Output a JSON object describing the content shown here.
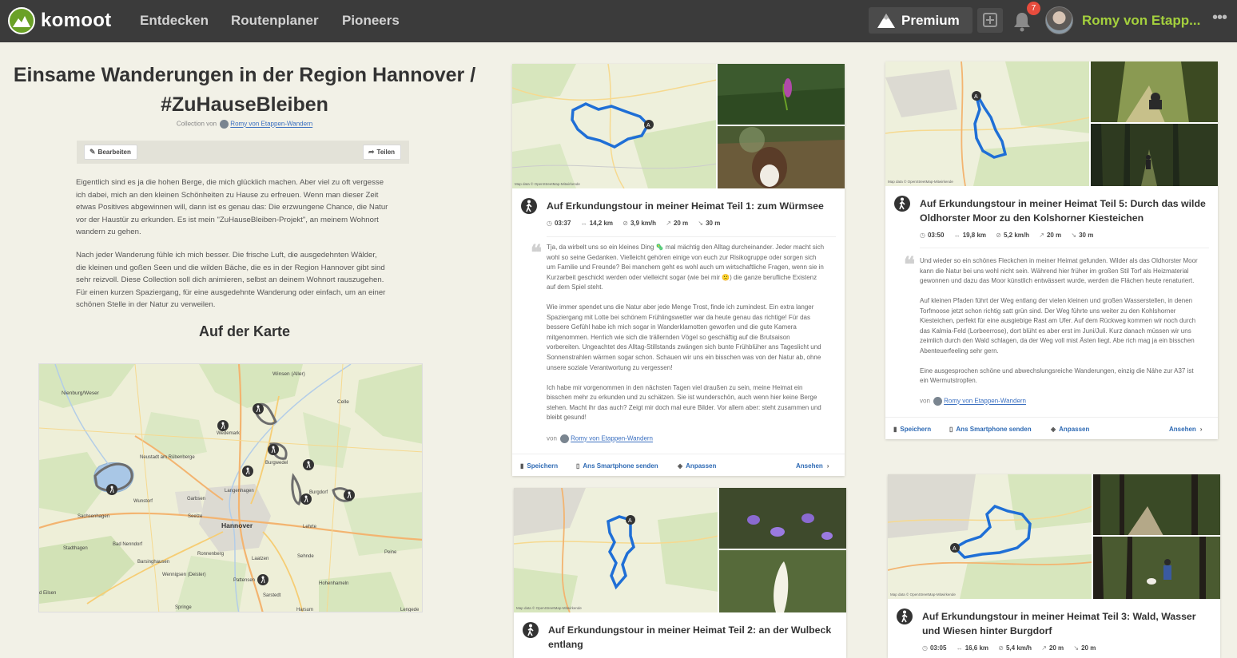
{
  "app": {
    "logo_text": "komoot",
    "nav": [
      "Entdecken",
      "Routenplaner",
      "Pioneers"
    ],
    "premium_label": "Premium",
    "notification_count": "7",
    "user_name": "Romy von Etapp...",
    "more": "•••"
  },
  "collection": {
    "title_line1": "Einsame Wanderungen in der Region Hannover /",
    "title_line2": "#ZuHauseBleiben",
    "byline_prefix": "Collection von",
    "byline_author": "Romy von Etappen-Wandern",
    "edit_label": "Bearbeiten",
    "share_label": "Teilen",
    "paragraph1_lines": [
      "Eigentlich sind es ja die hohen Berge, die mich glücklich machen. Aber viel zu oft vergesse",
      "ich dabei, mich an den kleinen Schönheiten zu Hause zu erfreuen. Wenn man dieser Zeit",
      "etwas Positives abgewinnen will, dann ist es genau das: Die erzwungene Chance, die Natur",
      "vor der Haustür zu erkunden. Es ist mein \"ZuHauseBleiben-Projekt\", an meinem Wohnort",
      "wandern zu gehen."
    ],
    "paragraph2_lines": [
      "Nach jeder Wanderung fühle ich mich besser. Die frische Luft, die ausgedehnten Wälder,",
      "die kleinen und goßen Seen und die wilden Bäche, die es in der Region Hannover gibt sind",
      "sehr reizvoll. Diese Collection soll dich animieren, selbst an deinem Wohnort rauszugehen.",
      "Für einen kurzen Spaziergang, für eine ausgedehnte Wanderung oder einfach, um an einer",
      "schönen Stelle in der Natur zu verweilen."
    ],
    "map_heading": "Auf der Karte"
  },
  "overview_map_labels": {
    "winsen": "Winsen (Aller)",
    "nienburg": "Nienburg/Weser",
    "celle": "Celle",
    "wedemark": "Wedemark",
    "neustadt": "Neustadt am Rübenberge",
    "burgwedel": "Burgwedel",
    "langenhagen": "Langenhagen",
    "burgdorf": "Burgdorf",
    "wunstorf": "Wunstorf",
    "garbsen": "Garbsen",
    "sachsenhagen": "Sachsenhagen",
    "seelze": "Seelze",
    "hannover": "Hannover",
    "lehrte": "Lehrte",
    "stadthagen": "Stadthagen",
    "badnenndorf": "Bad Nenndorf",
    "ronnenberg": "Ronnenberg",
    "sehnde": "Sehnde",
    "peine": "Peine",
    "barsinghausen": "Barsinghausen",
    "laatzen": "Laatzen",
    "wennigsen": "Wennigsen (Deister)",
    "pattensen": "Pattensen",
    "hohenhameln": "Hohenhameln",
    "elsen": "d Eilsen",
    "sarstedt": "Sarstedt",
    "springe": "Springe",
    "harsum": "Harsum",
    "lengede": "Lengede"
  },
  "tours": [
    {
      "title_lines": [
        "Auf Erkundungstour in meiner Heimat Teil 1: zum Würmsee"
      ],
      "duration": "03:37",
      "distance": "14,2 km",
      "speed": "3,9 km/h",
      "up": "20 m",
      "down": "30 m",
      "paragraphs": [
        [
          "Tja, da wirbelt uns so ein kleines Ding 🦠 mal mächtig den Alltag durcheinander. Jeder macht sich",
          "wohl so seine Gedanken. Vielleicht gehören einige von euch zur Risikogruppe oder sorgen sich",
          "um Familie und Freunde? Bei manchem geht es wohl auch um wirtschaftliche Fragen, wenn sie in",
          "Kurzarbeit geschickt werden oder vielleicht sogar (wie bei mir 😕) die ganze berufliche Existenz",
          "auf dem Spiel steht."
        ],
        [
          "Wie immer spendet uns die Natur aber jede Menge Trost, finde ich zumindest. Ein extra langer",
          "Spaziergang mit Lotte bei schönem Frühlingswetter war da heute genau das richtige! Für das",
          "bessere Gefühl habe ich mich sogar in Wanderklamotten geworfen und die gute Kamera",
          "mitgenommen. Herrlich wie sich die trällernden Vögel so geschäftig auf die Brutsaison",
          "vorbereiten. Ungeachtet des Alltag-Stillstands zwängen sich bunte Frühblüher ans Tageslicht und",
          "Sonnenstrahlen wärmen sogar schon. Schauen wir uns ein bisschen was von der Natur ab, ohne",
          "unsere soziale Verantwortung zu vergessen!"
        ],
        [
          "Ich habe mir vorgenommen in den nächsten Tagen viel draußen zu sein, meine Heimat ein",
          "bisschen mehr zu erkunden und zu schätzen. Sie ist wunderschön, auch wenn hier keine Berge",
          "stehen. Macht ihr das auch? Zeigt mir doch mal eure Bilder. Vor allem aber: steht zusammen und",
          "bleibt gesund!"
        ]
      ],
      "by_prefix": "von",
      "by_author": "Romy von Etappen-Wandern",
      "save": "Speichern",
      "send": "Ans Smartphone senden",
      "adjust": "Anpassen",
      "view": "Ansehen",
      "map_credit": "Map data © OpenStreetMap-Mitwirkende"
    },
    {
      "title_lines": [
        "Auf Erkundungstour in meiner Heimat Teil 5: Durch das wilde",
        "Oldhorster Moor zu den Kolshorner Kiesteichen"
      ],
      "duration": "03:50",
      "distance": "19,8 km",
      "speed": "5,2 km/h",
      "up": "20 m",
      "down": "30 m",
      "paragraphs": [
        [
          "Und wieder so ein schönes Fleckchen in meiner Heimat gefunden. Wilder als das Oldhorster Moor",
          "kann die Natur bei uns wohl nicht sein. Während hier früher im großen Stil Torf als Heizmaterial",
          "gewonnen und dazu das Moor künstlich entwässert wurde, werden die Flächen heute renaturiert."
        ],
        [
          "Auf kleinen Pfaden führt der Weg entlang der vielen kleinen und großen Wasserstellen, in denen",
          "Torfmoose jetzt schon richtig satt grün sind. Der Weg führte uns weiter zu den Kohlshorner",
          "Kiesteichen, perfekt für eine ausgiebige Rast am Ufer. Auf dem Rückweg kommen wir noch durch",
          "das Kalmia-Feld (Lorbeerrose), dort blüht es aber erst im Juni/Juli. Kurz danach müssen wir uns",
          "zeimlich durch den Wald schlagen, da der Weg voll mist Ästen liegt. Abe rich mag ja ein bisschen",
          "Abenteuerfeeling sehr gern."
        ],
        [
          "Eine ausgesprochen schöne und abwechslungsreiche Wanderungen, einzig die Nähe zur A37 ist",
          "ein Wermutstropfen."
        ]
      ],
      "by_prefix": "von",
      "by_author": "Romy von Etappen-Wandern",
      "save": "Speichern",
      "send": "Ans Smartphone senden",
      "adjust": "Anpassen",
      "view": "Ansehen",
      "map_credit": "Map data © OpenStreetMap-Mitwirkende"
    },
    {
      "title_lines": [
        "Auf Erkundungstour in meiner Heimat Teil 2: an der Wulbeck",
        "entlang"
      ],
      "map_credit": "Map data © OpenStreetMap-Mitwirkende"
    },
    {
      "title_lines": [
        "Auf Erkundungstour in meiner Heimat Teil 3: Wald, Wasser",
        "und Wiesen hinter Burgdorf"
      ],
      "duration": "03:05",
      "distance": "16,6 km",
      "speed": "5,4 km/h",
      "up": "20 m",
      "down": "20 m",
      "map_credit": "Map data © OpenStreetMap-Mitwirkende"
    }
  ],
  "icons": {
    "logo": "komoot-logo-icon",
    "premium": "mountain-icon",
    "plus": "plus-icon",
    "bell": "bell-icon",
    "edit": "pencil-icon",
    "share": "share-arrow-icon",
    "hike": "hiker-icon",
    "time": "clock-icon",
    "distance": "distance-icon",
    "speed": "speed-icon",
    "up": "arrow-up-icon",
    "down": "arrow-down-icon",
    "save": "bookmark-icon",
    "send": "smartphone-icon",
    "adjust": "diamond-icon",
    "view": "chevron-right-icon"
  },
  "colors": {
    "topbar": "#3b3b3b",
    "brand_green": "#6aa127",
    "user_green": "#a4d03d",
    "link_blue": "#2e6ab4",
    "route_blue": "#1f6fd6",
    "page_bg": "#f2f1e7"
  }
}
